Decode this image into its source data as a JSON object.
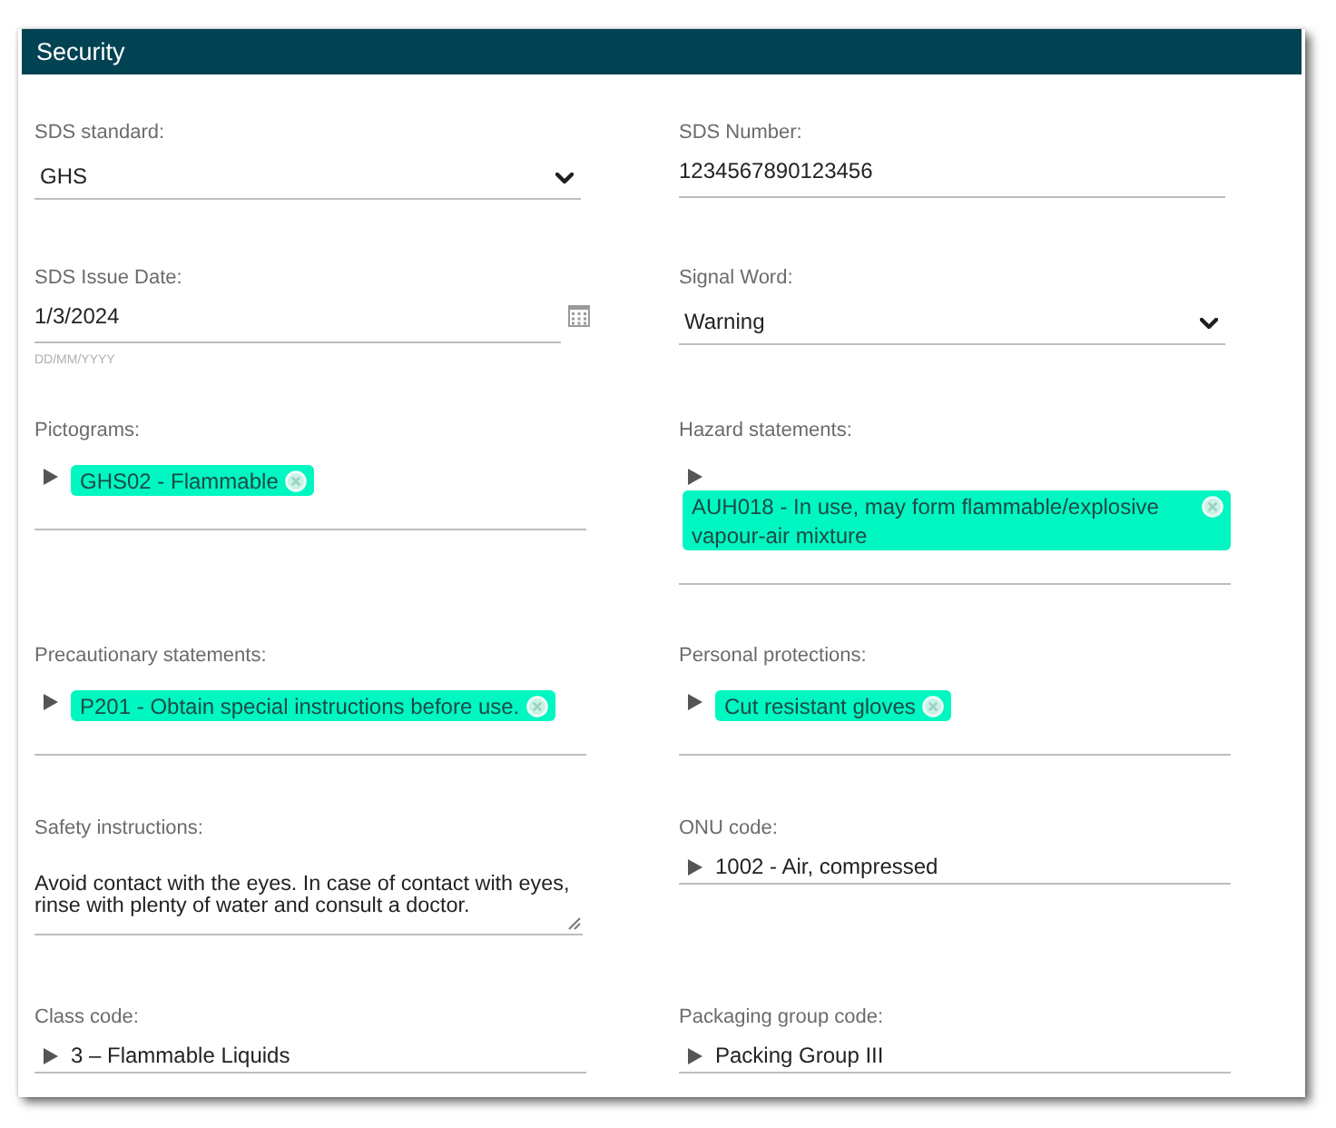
{
  "panel": {
    "title": "Security"
  },
  "fields": [
    {
      "kind": "select",
      "label": "SDS standard:",
      "value": "GHS"
    },
    {
      "kind": "text",
      "label": "SDS Number:",
      "value": "1234567890123456"
    },
    {
      "kind": "date",
      "label": "SDS Issue Date:",
      "value": "1/3/2024",
      "format_hint": "DD/MM/YYYY"
    },
    {
      "kind": "select",
      "label": "Signal Word:",
      "value": "Warning"
    },
    {
      "kind": "tags",
      "label": "Pictograms:",
      "tags": [
        "GHS02 - Flammable"
      ]
    },
    {
      "kind": "tags",
      "label": "Hazard statements:",
      "tags": [
        "AUH018 - In use, may form flammable/explosive vapour-air mixture"
      ]
    },
    {
      "kind": "tags",
      "label": "Precautionary statements:",
      "tags": [
        "P201 - Obtain special instructions before use."
      ]
    },
    {
      "kind": "tags",
      "label": "Personal protections:",
      "tags": [
        "Cut resistant gloves"
      ]
    },
    {
      "kind": "textarea",
      "label": "Safety instructions:",
      "value": "Avoid contact with the eyes. In case of contact with eyes, rinse with plenty of water and consult a doctor."
    },
    {
      "kind": "tree",
      "label": "ONU code:",
      "value": "1002 - Air, compressed"
    },
    {
      "kind": "tree",
      "label": "Class code:",
      "value": "3 – Flammable Liquids"
    },
    {
      "kind": "tree",
      "label": "Packaging group code:",
      "value": "Packing Group III"
    }
  ]
}
